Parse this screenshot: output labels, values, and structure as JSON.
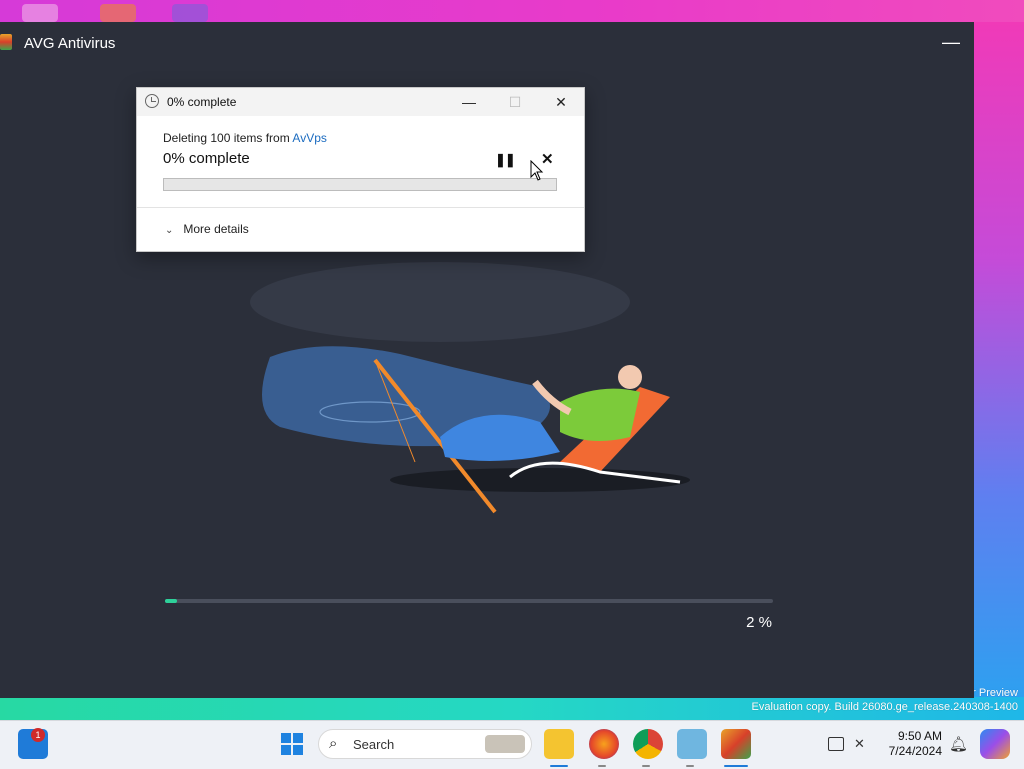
{
  "avg_window": {
    "title": "AVG Antivirus",
    "minimize_glyph": "—",
    "progress_percent": 2,
    "percent_label": "2 %"
  },
  "delete_dialog": {
    "title": "0% complete",
    "minimize_glyph": "—",
    "maximize_glyph": "☐",
    "close_glyph": "✕",
    "deleting_prefix": "Deleting 100 items from ",
    "deleting_source": "AvVps",
    "status": "0% complete",
    "pause_glyph": "❚❚",
    "stop_glyph": "✕",
    "progress_percent": 0,
    "more_details": "More details",
    "more_chevron": "⌄"
  },
  "watermark": {
    "line1": "r Preview",
    "line2": "Evaluation copy. Build 26080.ge_release.240308-1400"
  },
  "taskbar": {
    "search_icon": "⌕",
    "search_label": "Search",
    "widgets_badge": "1",
    "time": "9:50 AM",
    "date": "7/24/2024",
    "notification_icon": "bell-icon"
  },
  "colors": {
    "accent_progress": "#2ed19a",
    "avg_background": "#2b2f3a",
    "link": "#1c6cc0"
  }
}
